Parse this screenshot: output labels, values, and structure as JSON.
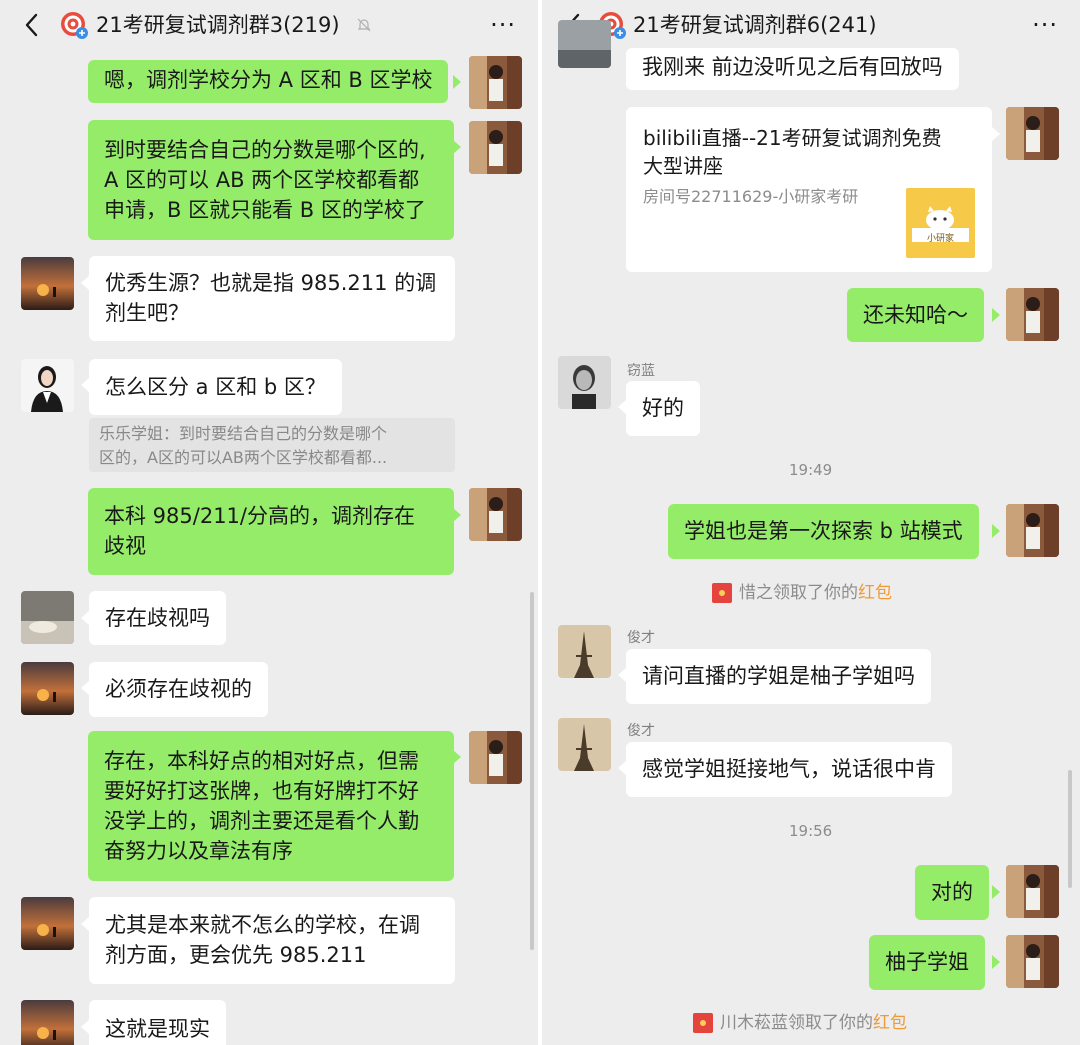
{
  "left": {
    "title": "21考研复试调剂群3(219)",
    "messages": {
      "m1": "嗯，调剂学校分为 A 区和 B 区学校",
      "m2": [
        "到时要结合自己的分数是哪个区的,",
        "A 区的可以 AB 两个区学校都看都",
        "申请，B 区就只能看 B 区的学校了"
      ],
      "m3": [
        "优秀生源？也就是指 985.211 的调",
        "剂生吧？"
      ],
      "m4": "怎么区分 a 区和 b 区？",
      "m4_quote": [
        "乐乐学姐：到时要结合自己的分数是哪个",
        "区的，A区的可以AB两个区学校都看都..."
      ],
      "m5": [
        "本科 985/211/分高的，调剂存在",
        "歧视"
      ],
      "m6": "存在歧视吗",
      "m7": "必须存在歧视的",
      "m8": [
        "存在，本科好点的相对好点，但需",
        "要好好打这张牌，也有好牌打不好",
        "没学上的，调剂主要还是看个人勤",
        "奋努力以及章法有序"
      ],
      "m9": [
        "尤其是本来就不怎么的学校，在调",
        "剂方面，更会优先 985.211"
      ],
      "m10": "这就是现实"
    }
  },
  "right": {
    "title": "21考研复试调剂群6(241)",
    "messages": {
      "r0": "我刚来 前边没听见之后有回放吗",
      "card_title": [
        "bilibili直播--21考研复试调剂免费",
        "大型讲座"
      ],
      "card_sub": "房间号22711629-小研家考研",
      "card_thumb_label": "小研家",
      "r1": "还未知哈～",
      "r2_sender": "窃蓝",
      "r2": "好的",
      "t1": "19:49",
      "r3": "学姐也是第一次探索 b 站模式",
      "n1_prefix": "惜之领取了你的",
      "n1_rp": "红包",
      "r4_sender": "俊才",
      "r4": "请问直播的学姐是柚子学姐吗",
      "r5_sender": "俊才",
      "r5": "感觉学姐挺接地气，说话很中肯",
      "t2": "19:56",
      "r6": "对的",
      "r7": "柚子学姐",
      "n2_prefix": "川木菘蓝领取了你的",
      "n2_rp": "红包"
    }
  },
  "colors": {
    "me_bubble": "#95ec69",
    "other_bubble": "#ffffff",
    "bg": "#ededed",
    "red_packet_text": "#f09a37"
  },
  "icons": {
    "back": "chevron-left-icon",
    "group": "group-target-icon",
    "mute": "bell-muted-icon",
    "more": "more-dots-icon",
    "red_packet": "red-packet-icon"
  },
  "more_label": "···"
}
